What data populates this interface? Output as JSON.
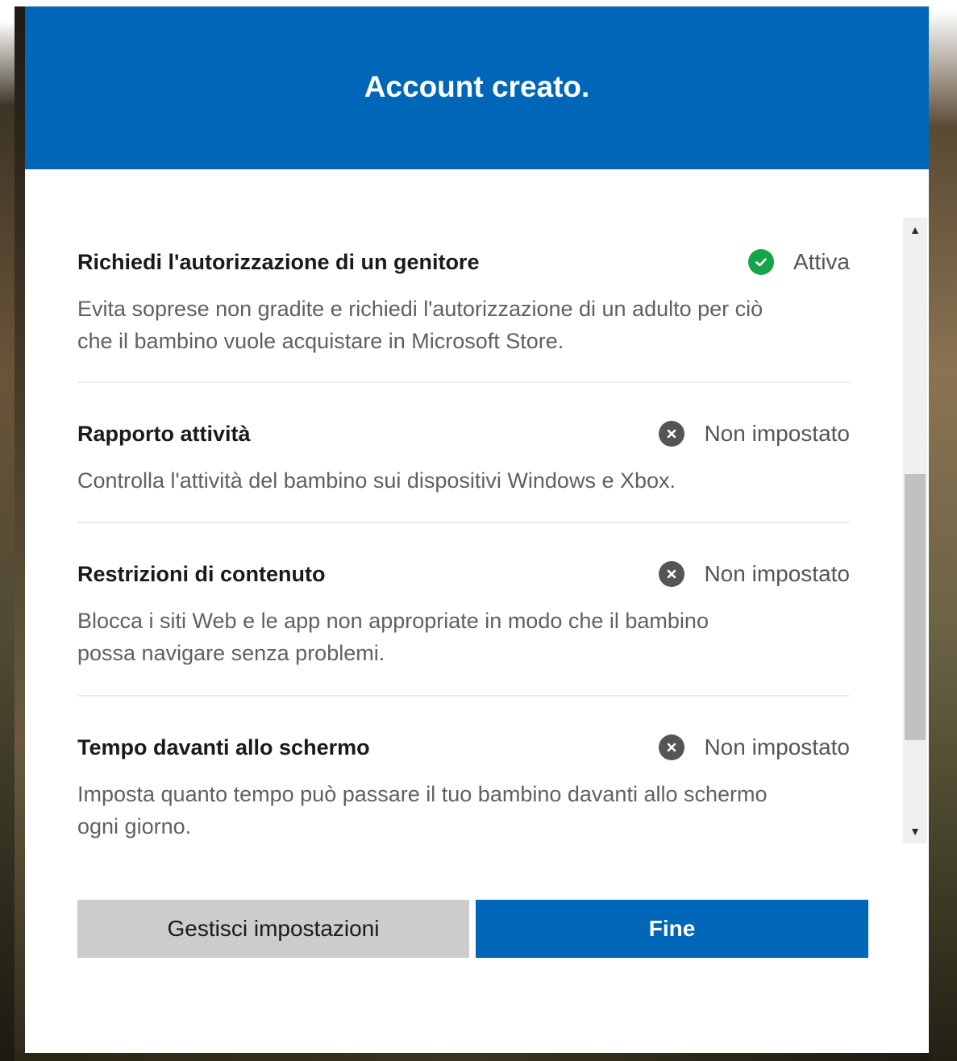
{
  "dialog": {
    "title": "Account creato."
  },
  "settings": [
    {
      "title": "Richiedi l'autorizzazione di un genitore",
      "status": "Attiva",
      "status_icon": "check-circle-icon",
      "description_lines": [
        "Evita sopresе non gradite e richiedi l'autorizzazione di un adulto per ciò",
        "che il bambino vuole acquistare in Microsoft Store."
      ]
    },
    {
      "title": "Rapporto attività",
      "status": "Non impostato",
      "status_icon": "x-circle-icon",
      "description_lines": [
        "Controlla l'attività del bambino sui dispositivi Windows e Xbox."
      ]
    },
    {
      "title": "Restrizioni di contenuto",
      "status": "Non impostato",
      "status_icon": "x-circle-icon",
      "description_lines": [
        "Blocca i siti Web e le app non appropriate in modo che il bambino",
        "possa navigare senza problemi."
      ]
    },
    {
      "title": "Tempo davanti allo schermo",
      "status": "Non impostato",
      "status_icon": "x-circle-icon",
      "description_lines": [
        "Imposta quanto tempo può passare il tuo bambino davanti allo schermo",
        "ogni giorno."
      ]
    }
  ],
  "buttons": {
    "manage_label": "Gestisci impostazioni",
    "done_label": "Fine"
  },
  "colors": {
    "accent": "#0067b8",
    "status_on": "#16a34a",
    "status_off": "#555555"
  }
}
